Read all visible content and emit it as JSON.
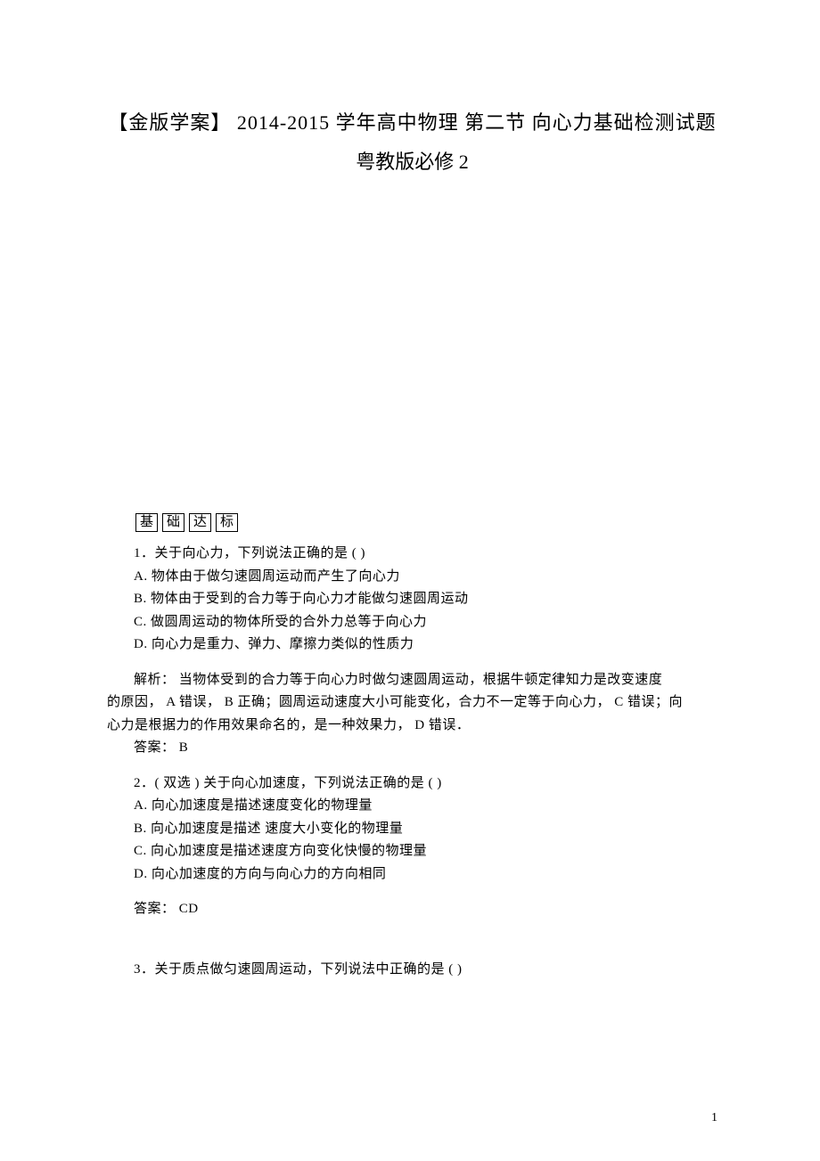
{
  "title": "【金版学案】 2014-2015 学年高中物理  第二节  向心力基础检测试题",
  "subtitle": "粤教版必修 2",
  "section_heading_chars": [
    "基",
    "础",
    "达",
    "标"
  ],
  "q1": {
    "stem": "1．关于向心力，下列说法正确的是    (      )",
    "optA": "A. 物体由于做匀速圆周运动而产生了向心力",
    "optB": "B. 物体由于受到的合力等于向心力才能做匀速圆周运动",
    "optC": "C. 做圆周运动的物体所受的合外力总等于向心力",
    "optD": "D. 向心力是重力、弹力、摩擦力类似的性质力",
    "analysis_line1": "解析：  当物体受到的合力等于向心力时做匀速圆周运动，根据牛顿定律知力是改变速度",
    "analysis_line2": "的原因， A 错误， B 正确；圆周运动速度大小可能变化，合力不一定等于向心力，       C 错误；向",
    "analysis_line3": "心力是根据力的作用效果命名的，是一种效果力，      D 错误．",
    "answer": "答案： B"
  },
  "q2": {
    "stem": "2．( 双选 ) 关于向心加速度，下列说法正确的是    (      )",
    "optA": "A. 向心加速度是描述速度变化的物理量",
    "optB": "B. 向心加速度是描述   速度大小变化的物理量",
    "optC": "C. 向心加速度是描述速度方向变化快慢的物理量",
    "optD": "D. 向心加速度的方向与向心力的方向相同",
    "answer": "答案： CD"
  },
  "q3": {
    "stem": "3．关于质点做匀速圆周运动，下列说法中正确的是      (      )"
  },
  "page_number": "1"
}
